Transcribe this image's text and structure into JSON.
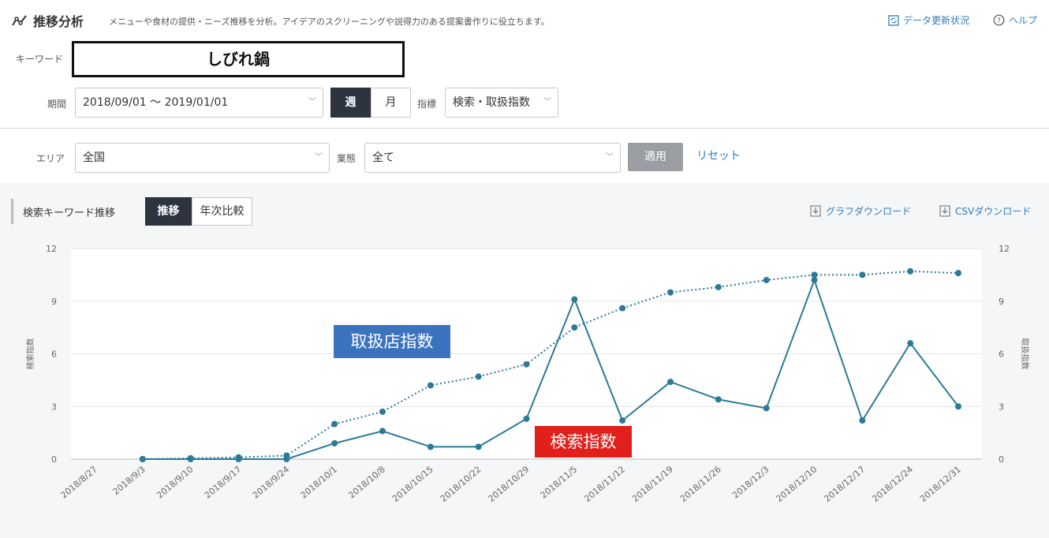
{
  "header": {
    "title": "推移分析",
    "description": "メニューや食材の提供・ニーズ推移を分析。アイデアのスクリーニングや説得力のある提案書作りに役立ちます。",
    "data_update_label": "データ更新状況",
    "help_label": "ヘルプ",
    "icon": "trend-analysis-icon"
  },
  "filters": {
    "keyword_label": "キーワード",
    "keyword_value": "しびれ鍋",
    "period_label": "期間",
    "period_value": "2018/09/01 〜 2019/01/01",
    "granularity": {
      "week_label": "週",
      "month_label": "月",
      "selected": "週"
    },
    "metric_label": "指標",
    "metric_value": "検索・取扱指数",
    "area_label": "エリア",
    "area_value": "全国",
    "business_label": "業態",
    "business_value": "全て",
    "apply_label": "適用",
    "reset_label": "リセット"
  },
  "panel": {
    "title": "検索キーワード推移",
    "tabs": [
      {
        "label": "推移",
        "active": true
      },
      {
        "label": "年次比較",
        "active": false
      }
    ],
    "graph_download_label": "グラフダウンロード",
    "csv_download_label": "CSVダウンロード"
  },
  "annotations": {
    "handling": "取扱店指数",
    "search": "検索指数"
  },
  "chart_data": {
    "type": "line",
    "categories": [
      "2018/8/27",
      "2018/9/3",
      "2018/9/10",
      "2018/9/17",
      "2018/9/24",
      "2018/10/1",
      "2018/10/8",
      "2018/10/15",
      "2018/10/22",
      "2018/10/29",
      "2018/11/5",
      "2018/11/12",
      "2018/11/19",
      "2018/11/26",
      "2018/12/3",
      "2018/12/10",
      "2018/12/17",
      "2018/12/24",
      "2018/12/31"
    ],
    "ylabel_left": "検索指数",
    "ylabel_right": "取扱指数",
    "ylim": [
      0,
      12
    ],
    "yticks": [
      0,
      3,
      6,
      9,
      12
    ],
    "grid": true,
    "series": [
      {
        "key": "search",
        "style": "solid",
        "color": "#2b7a99",
        "values": [
          null,
          0,
          0,
          0,
          0,
          0.9,
          1.6,
          0.7,
          0.7,
          2.3,
          9.1,
          2.2,
          4.4,
          3.4,
          2.9,
          10.2,
          2.2,
          6.6,
          3.0
        ]
      },
      {
        "key": "handling",
        "style": "dotted",
        "color": "#2b7a99",
        "values": [
          null,
          0,
          0.05,
          0.1,
          0.2,
          2.0,
          2.7,
          4.2,
          4.7,
          5.4,
          7.5,
          8.6,
          9.5,
          9.8,
          10.2,
          10.5,
          10.5,
          10.7,
          10.6
        ]
      }
    ]
  }
}
